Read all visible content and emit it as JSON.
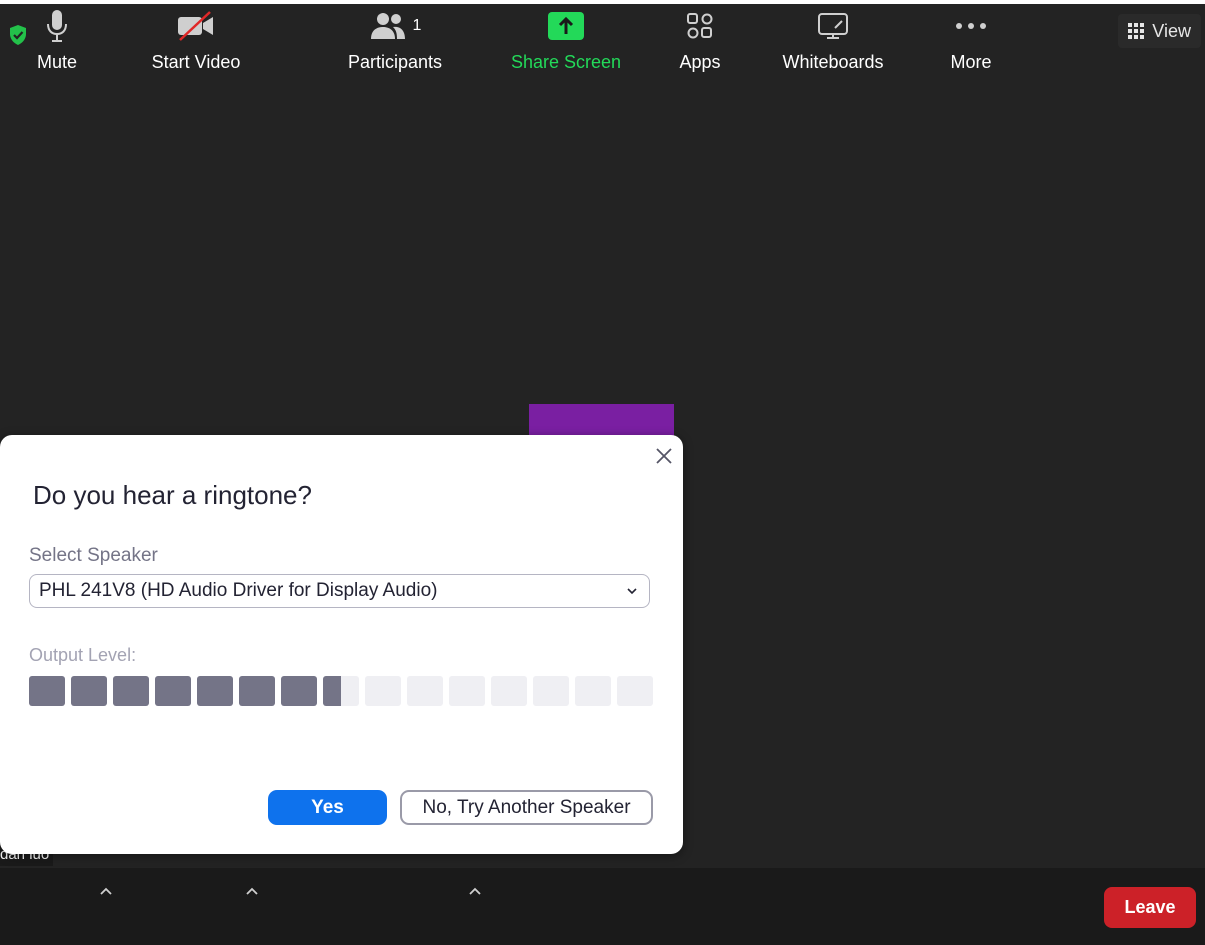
{
  "meeting": {
    "view_label": "View",
    "participant_name": "dan luo"
  },
  "dialog": {
    "title": "Do you hear a ringtone?",
    "speaker_label": "Select Speaker",
    "speaker_value": "PHL 241V8 (HD Audio Driver for Display Audio)",
    "output_label": "Output Level:",
    "output_level_segments_total": 15,
    "output_level_filled": 7.5,
    "yes_label": "Yes",
    "no_label": "No, Try Another Speaker"
  },
  "toolbar": {
    "mute_label": "Mute",
    "video_label": "Start Video",
    "participants_label": "Participants",
    "participants_count": "1",
    "share_label": "Share Screen",
    "apps_label": "Apps",
    "whiteboards_label": "Whiteboards",
    "more_label": "More",
    "leave_label": "Leave"
  },
  "colors": {
    "accent_blue": "#0e72ed",
    "share_green": "#23d959",
    "leave_red": "#cc2128",
    "shield_green": "#23c14a"
  }
}
